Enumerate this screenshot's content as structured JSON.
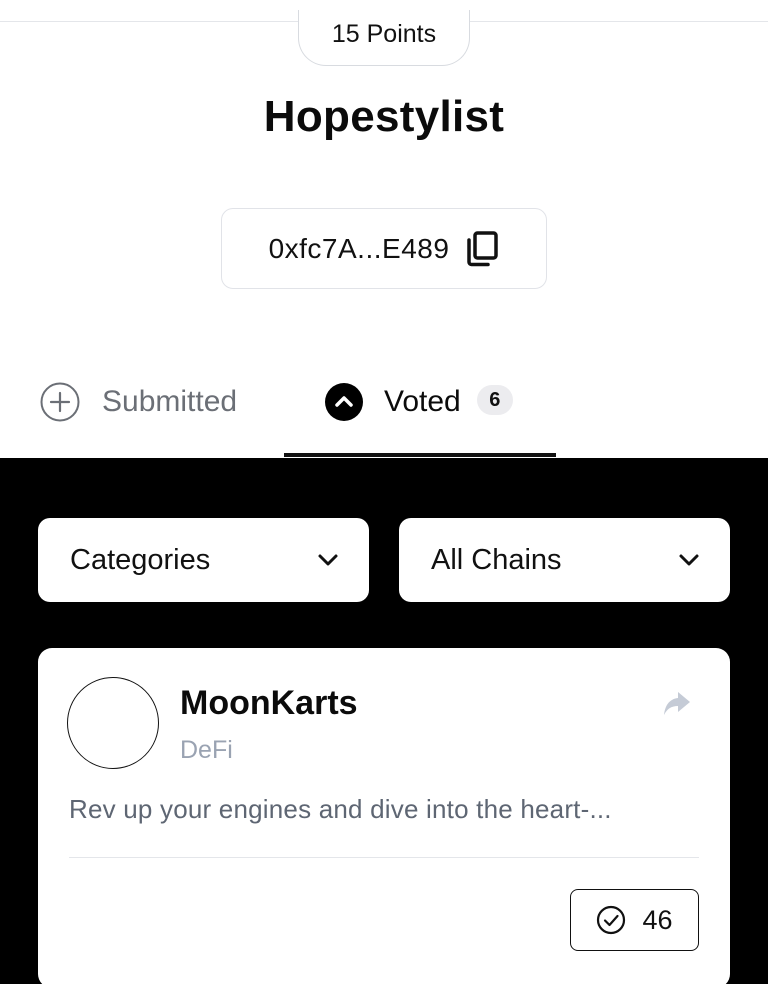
{
  "profile": {
    "points_label": "15 Points",
    "username": "Hopestylist",
    "wallet_address": "0xfc7A...E489"
  },
  "tabs": [
    {
      "label": "Submitted",
      "icon": "plus-circle-icon",
      "active": false
    },
    {
      "label": "Voted",
      "icon": "chevron-up-circle-icon",
      "active": true,
      "count": "6"
    }
  ],
  "filters": {
    "categories_label": "Categories",
    "chains_label": "All Chains"
  },
  "projects": [
    {
      "name": "MoonKarts",
      "category": "DeFi",
      "description": "Rev up your engines and dive into the heart-...",
      "votes": "46"
    }
  ],
  "colors": {
    "accent": "#000000",
    "muted_text": "#6b6f76",
    "category_text": "#9aa3b2",
    "badge_bg": "#ececef",
    "border": "#e1e3e8"
  }
}
